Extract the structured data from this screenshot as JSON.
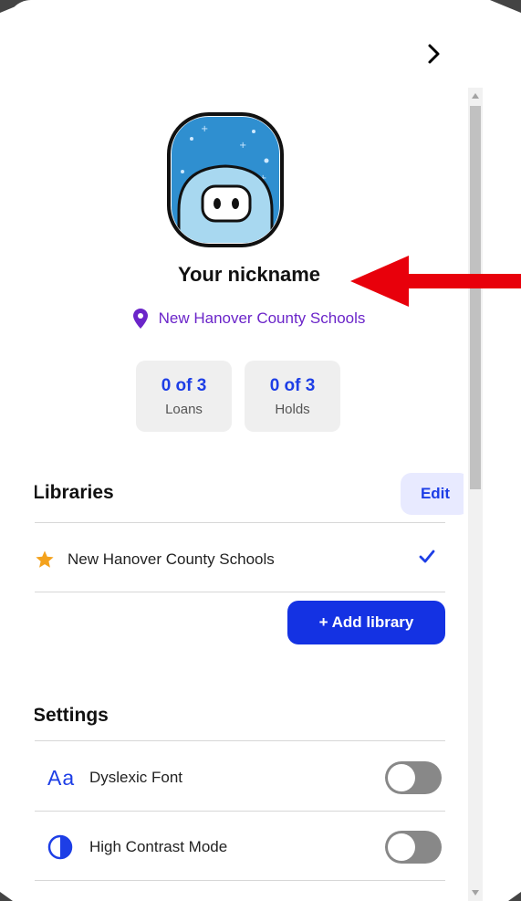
{
  "profile": {
    "nickname": "Your nickname",
    "library_name": "New Hanover County Schools"
  },
  "counts": [
    {
      "value": "0 of 3",
      "label": "Loans"
    },
    {
      "value": "0 of 3",
      "label": "Holds"
    }
  ],
  "libraries": {
    "title": "Libraries",
    "edit_label": "Edit",
    "items": [
      {
        "name": "New Hanover County Schools",
        "starred": true,
        "selected": true
      }
    ],
    "add_label": "+ Add library"
  },
  "settings": {
    "title": "Settings",
    "items": [
      {
        "icon_text": "Aa",
        "label": "Dyslexic Font",
        "enabled": false
      },
      {
        "icon_text": "",
        "label": "High Contrast Mode",
        "enabled": false
      }
    ]
  },
  "icons": {
    "close": "chevron-right-icon",
    "location": "map-pin-icon",
    "star": "star-icon",
    "check": "checkmark-icon",
    "contrast": "contrast-icon",
    "avatar": "robot-avatar"
  },
  "colors": {
    "accent": "#1d3ee6",
    "button": "#1432e3",
    "location": "#6b25c9",
    "star": "#f4a21c",
    "arrow": "#e8000b",
    "toggle_off": "#888888"
  }
}
